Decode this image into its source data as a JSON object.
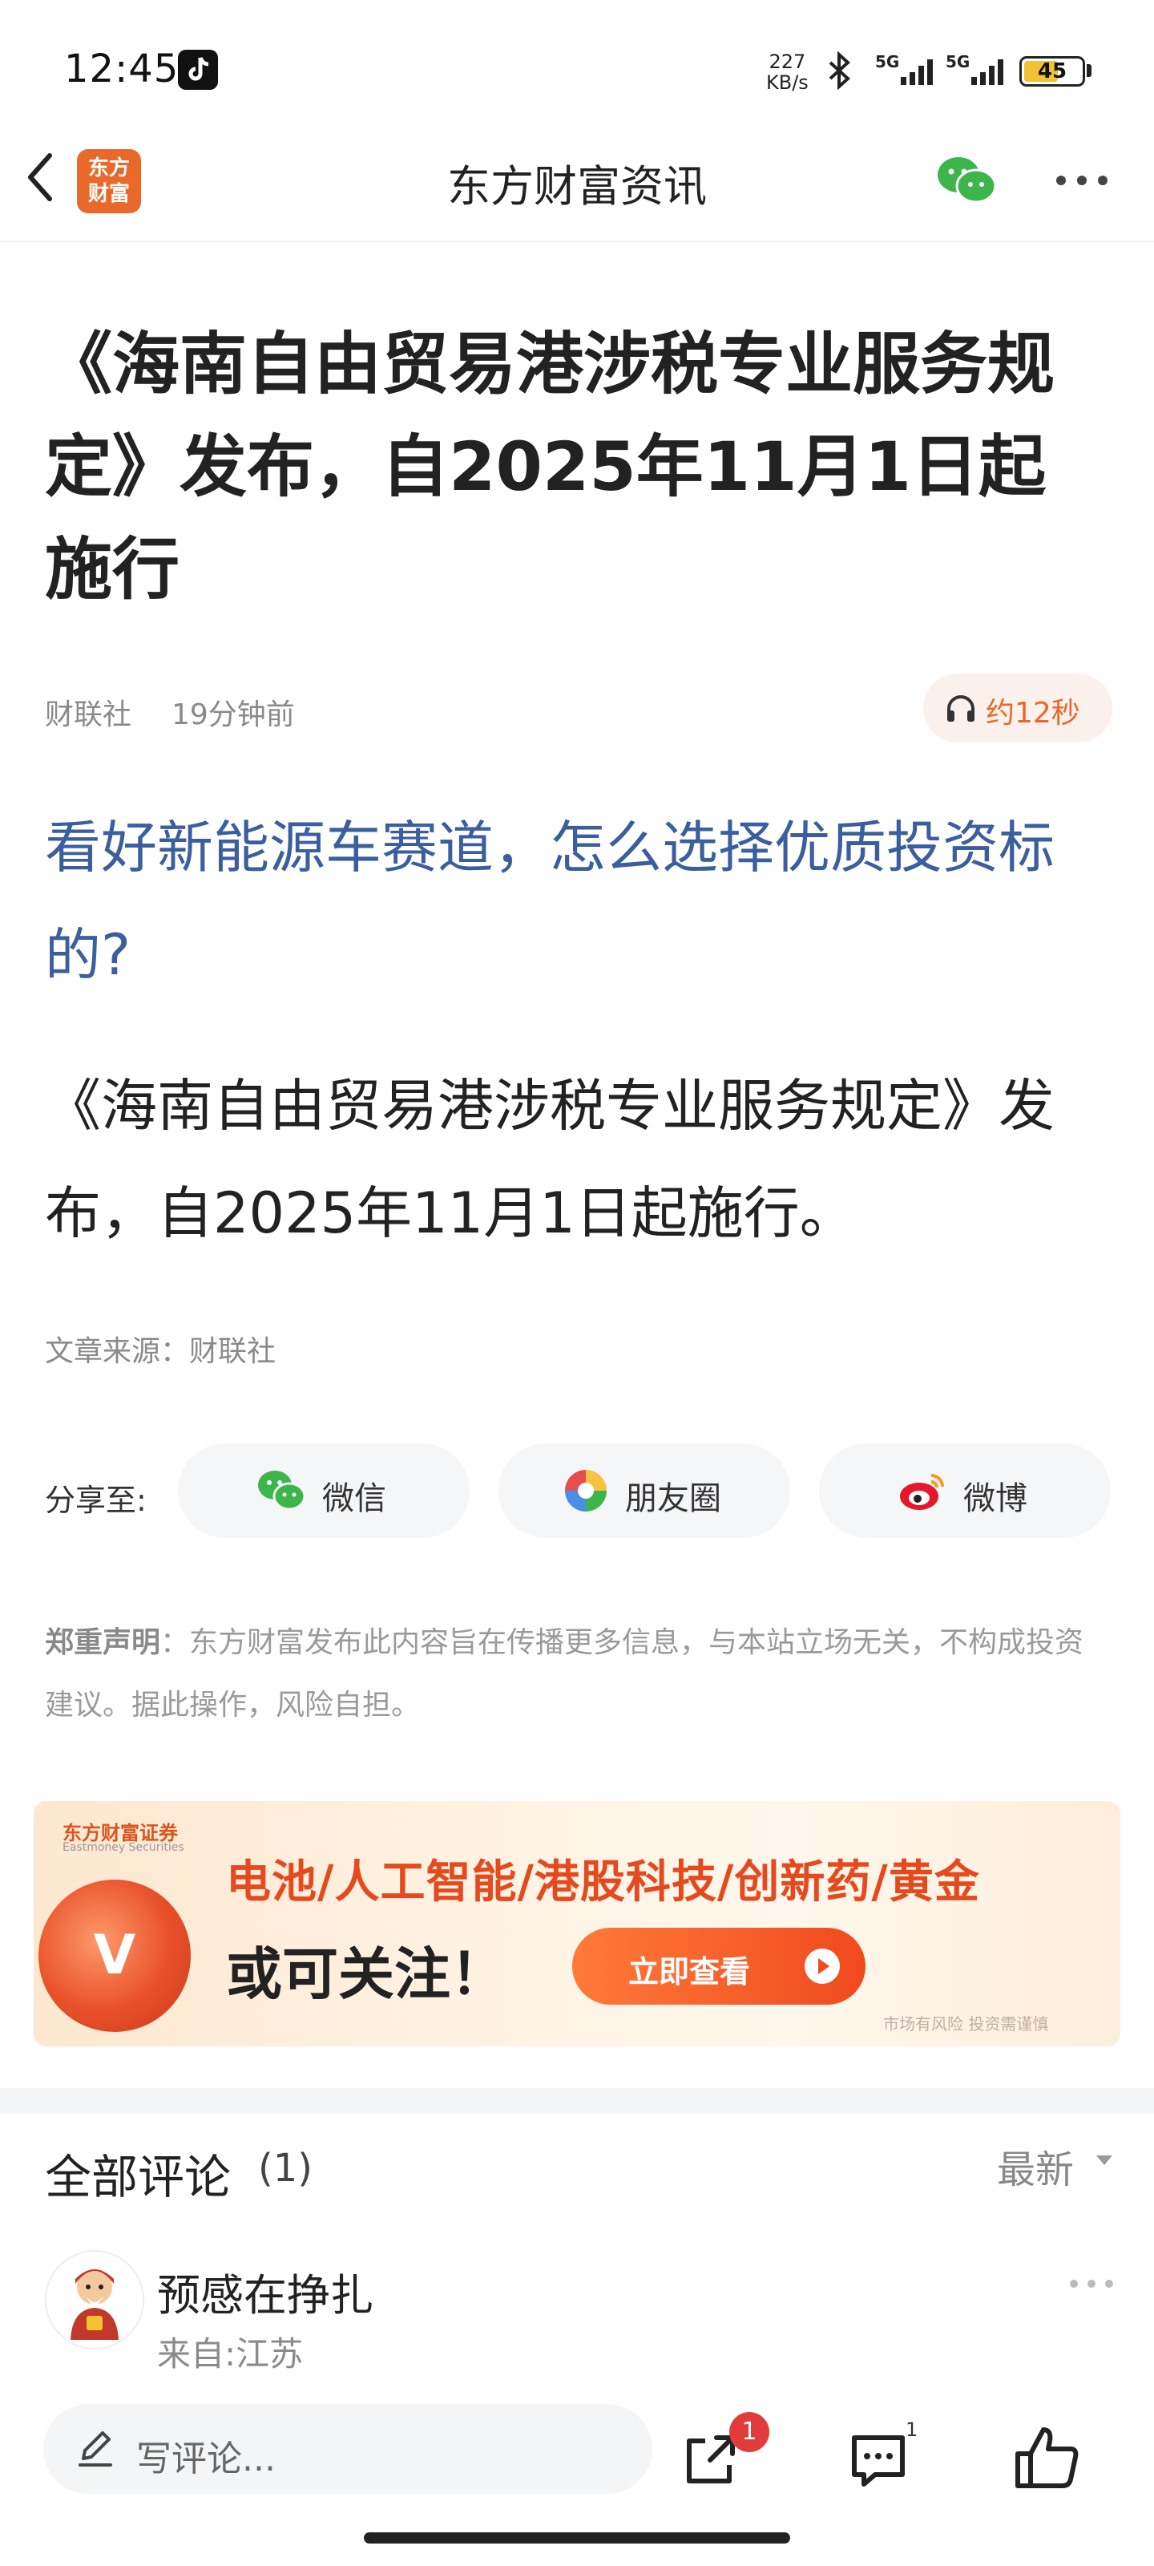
{
  "status_bar": {
    "time": "12:45",
    "net_speed_value": "227",
    "net_speed_unit": "KB/s",
    "signal1": "5G",
    "signal2": "5G",
    "battery": "45"
  },
  "nav": {
    "logo_line1": "东方",
    "logo_line2": "财富",
    "title": "东方财富资讯"
  },
  "article": {
    "title": "《海南自由贸易港涉税专业服务规定》发布，自2025年11月1日起施行",
    "source": "财联社",
    "time": "19分钟前",
    "listen_label": "约12秒",
    "promo_link": "看好新能源车赛道，怎么选择优质投资标的?",
    "body": "《海南自由贸易港涉税专业服务规定》发布，自2025年11月1日起施行。",
    "source_line": "文章来源：财联社"
  },
  "share": {
    "label": "分享至:",
    "wechat": "微信",
    "moments": "朋友圈",
    "weibo": "微博"
  },
  "disclaimer": {
    "title": "郑重声明",
    "text": "：东方财富发布此内容旨在传播更多信息，与本站立场无关，不构成投资建议。据此操作，风险自担。"
  },
  "ad": {
    "brand": "东方财富证券",
    "brand_en": "Eastmoney Securities",
    "line1": "电池/人工智能/港股科技/创新药/黄金",
    "line2": "或可关注！",
    "cta": "立即查看",
    "risk": "市场有风险 投资需谨慎"
  },
  "comments": {
    "title": "全部评论",
    "count": "(1)",
    "sort": "最新",
    "items": [
      {
        "username": "预感在挣扎",
        "location": "来自:江苏"
      }
    ]
  },
  "bottom_bar": {
    "placeholder": "写评论...",
    "share_badge": "1",
    "comment_count": "1"
  },
  "colors": {
    "accent": "#e8692a",
    "link": "#3b5f9e",
    "badge": "#e23b3b"
  }
}
